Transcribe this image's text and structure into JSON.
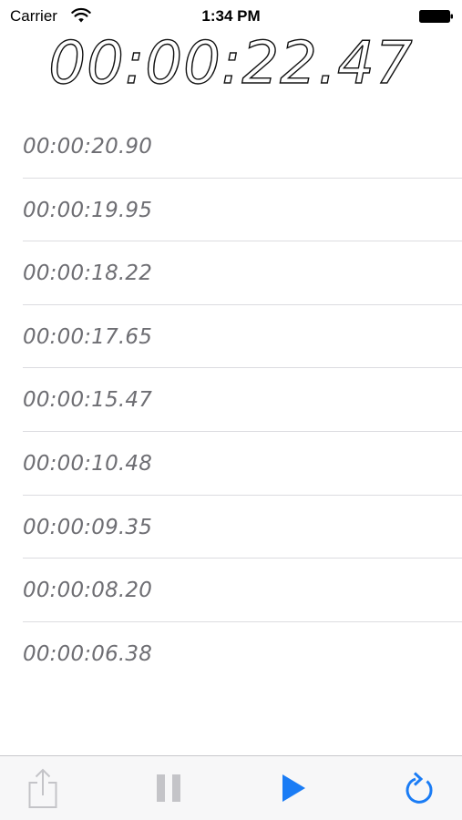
{
  "status_bar": {
    "carrier": "Carrier",
    "time": "1:34 PM",
    "wifi_icon": "wifi-icon",
    "battery_icon": "battery-icon"
  },
  "timer": {
    "display": "00:00:22.47"
  },
  "laps": [
    {
      "time": "00:00:20.90"
    },
    {
      "time": "00:00:19.95"
    },
    {
      "time": "00:00:18.22"
    },
    {
      "time": "00:00:17.65"
    },
    {
      "time": "00:00:15.47"
    },
    {
      "time": "00:00:10.48"
    },
    {
      "time": "00:00:09.35"
    },
    {
      "time": "00:00:08.20"
    },
    {
      "time": "00:00:06.38"
    }
  ],
  "toolbar": {
    "share_icon": "share-icon",
    "pause_icon": "pause-icon",
    "play_icon": "play-icon",
    "reset_icon": "refresh-icon",
    "share_enabled": false,
    "pause_enabled": false,
    "play_enabled": true,
    "reset_enabled": true
  },
  "colors": {
    "accent": "#1a7cf5",
    "disabled": "#c4c4c8",
    "lap_text": "#6e6e73",
    "separator": "#dcdce0",
    "toolbar_bg": "#f7f7f8"
  }
}
